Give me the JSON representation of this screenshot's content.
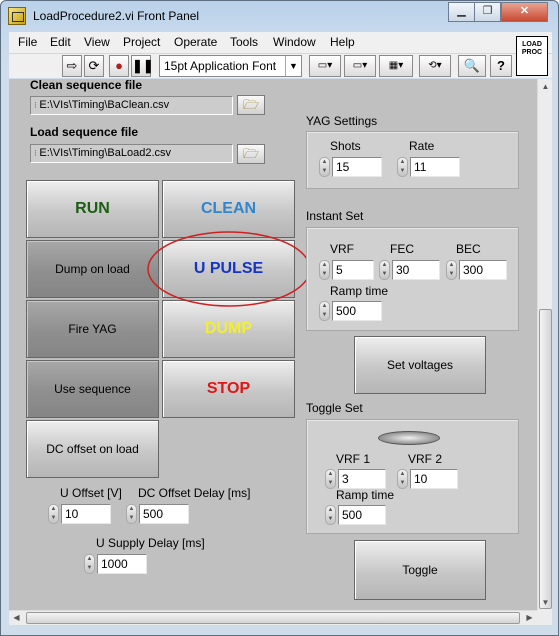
{
  "window": {
    "title": "LoadProcedure2.vi Front Panel",
    "minimize": "▁",
    "restore": "❐",
    "close": "✕"
  },
  "menu": [
    "File",
    "Edit",
    "View",
    "Project",
    "Operate",
    "Tools",
    "Window",
    "Help"
  ],
  "toolbar": {
    "font": "15pt Application Font"
  },
  "vi_icon": {
    "line1": "LOAD",
    "line2": "PROC"
  },
  "clean_file": {
    "label": "Clean sequence file",
    "value": "E:\\VIs\\Timing\\BaClean.csv"
  },
  "load_file": {
    "label": "Load sequence file",
    "value": "E:\\VIs\\Timing\\BaLoad2.csv"
  },
  "buttons": {
    "run": {
      "label": "RUN",
      "color": "#1e5e14"
    },
    "clean": {
      "label": "CLEAN",
      "color": "#2f86cf"
    },
    "dump_on_load": {
      "label": "Dump on load"
    },
    "u_pulse": {
      "label": "U PULSE",
      "color": "#1535c8"
    },
    "fire_yag": {
      "label": "Fire YAG"
    },
    "dump": {
      "label": "DUMP",
      "color": "#f3ee32"
    },
    "use_sequence": {
      "label": "Use sequence"
    },
    "stop": {
      "label": "STOP",
      "color": "#e01515"
    },
    "dc_offset_on_load": {
      "label": "DC offset on load"
    },
    "set_voltages": {
      "label": "Set voltages"
    },
    "toggle": {
      "label": "Toggle"
    }
  },
  "left_controls": {
    "u_offset": {
      "label": "U Offset [V]",
      "value": "10"
    },
    "dc_offset_delay": {
      "label": "DC Offset Delay [ms]",
      "value": "500"
    },
    "u_supply_delay": {
      "label": "U Supply Delay [ms]",
      "value": "1000"
    }
  },
  "yag": {
    "title": "YAG Settings",
    "shots_label": "Shots",
    "shots": "15",
    "rate_label": "Rate",
    "rate": "11"
  },
  "instant": {
    "title": "Instant Set",
    "vrf_label": "VRF",
    "vrf": "5",
    "fec_label": "FEC",
    "fec": "30",
    "bec_label": "BEC",
    "bec": "300",
    "ramp_label": "Ramp time",
    "ramp": "500"
  },
  "toggle_set": {
    "title": "Toggle Set",
    "vrf1_label": "VRF 1",
    "vrf1": "3",
    "vrf2_label": "VRF 2",
    "vrf2": "10",
    "ramp_label": "Ramp time",
    "ramp": "500"
  },
  "highlight_color": "#d01f1f"
}
